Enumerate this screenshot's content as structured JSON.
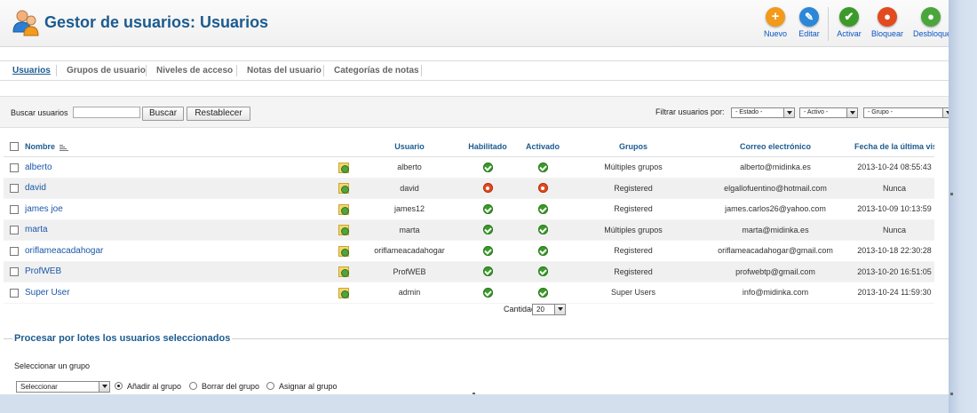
{
  "toolbar": {
    "title": "Gestor de usuarios: Usuarios",
    "buttons": [
      {
        "label": "Nuevo",
        "icon": "plus-icon",
        "color": "#f39a1a"
      },
      {
        "label": "Editar",
        "icon": "pencil-icon",
        "color": "#2c87d8"
      },
      {
        "label": "Activar",
        "icon": "check-icon",
        "color": "#3b9a2a"
      },
      {
        "label": "Bloquear",
        "icon": "block-icon",
        "color": "#e24b1f"
      },
      {
        "label": "Desbloquea",
        "icon": "unblock-icon",
        "color": "#4aa63a"
      }
    ]
  },
  "tabs": [
    "Usuarios",
    "Grupos de usuario",
    "Niveles de acceso",
    "Notas del usuario",
    "Categorías de notas"
  ],
  "search": {
    "label": "Buscar usuarios",
    "value": "",
    "search_button": "Buscar",
    "reset_button": "Restablecer"
  },
  "filters": {
    "label": "Filtrar usuarios por:",
    "estado": "- Estado -",
    "activo": "- Activo -",
    "grupo": "- Grupo -"
  },
  "table": {
    "headers": {
      "name": "Nombre",
      "username": "Usuario",
      "enabled": "Habilitado",
      "activated": "Activado",
      "groups": "Grupos",
      "email": "Correo electrónico",
      "last_visit": "Fecha de la última visita"
    },
    "rows": [
      {
        "name": "alberto",
        "username": "alberto",
        "enabled": true,
        "activated": true,
        "groups": "Múltiples grupos",
        "email": "alberto@midinka.es",
        "last_visit": "2013-10-24 08:55:43"
      },
      {
        "name": "david",
        "username": "david",
        "enabled": false,
        "activated": false,
        "groups": "Registered",
        "email": "elgallofuentino@hotmail.com",
        "last_visit": "Nunca"
      },
      {
        "name": "james joe",
        "username": "james12",
        "enabled": true,
        "activated": true,
        "groups": "Registered",
        "email": "james.carlos26@yahoo.com",
        "last_visit": "2013-10-09 10:13:59"
      },
      {
        "name": "marta",
        "username": "marta",
        "enabled": true,
        "activated": true,
        "groups": "Múltiples grupos",
        "email": "marta@midinka.es",
        "last_visit": "Nunca"
      },
      {
        "name": "oriflameacadahogar",
        "username": "oriflameacadahogar",
        "enabled": true,
        "activated": true,
        "groups": "Registered",
        "email": "oriflameacadahogar@gmail.com",
        "last_visit": "2013-10-18 22:30:28"
      },
      {
        "name": "ProfWEB",
        "username": "ProfWEB",
        "enabled": true,
        "activated": true,
        "groups": "Registered",
        "email": "profwebtp@gmail.com",
        "last_visit": "2013-10-20 16:51:05"
      },
      {
        "name": "Super User",
        "username": "admin",
        "enabled": true,
        "activated": true,
        "groups": "Super Users",
        "email": "info@midinka.com",
        "last_visit": "2013-10-24 11:59:30"
      }
    ]
  },
  "pagination": {
    "label": "Cantidad",
    "value": "20"
  },
  "batch": {
    "legend": "Procesar por lotes los usuarios seleccionados",
    "group_label": "Seleccionar un grupo",
    "group_select": "Seleccionar",
    "options": [
      "Añadir al grupo",
      "Borrar del grupo",
      "Asignar al grupo"
    ],
    "selected_option": "Añadir al grupo"
  }
}
